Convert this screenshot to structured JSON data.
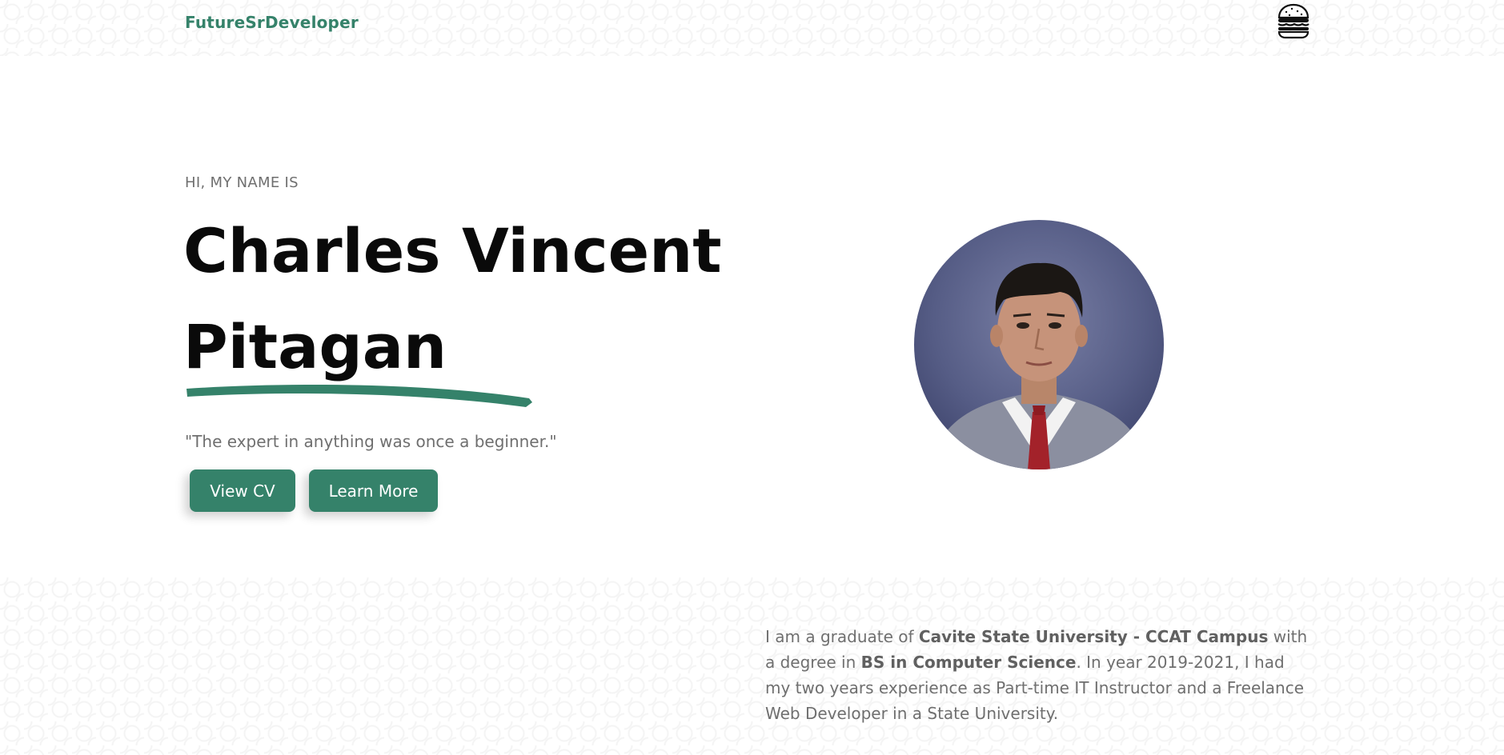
{
  "navbar": {
    "brand": "FutureSrDeveloper",
    "menu_icon": "hamburger-burger-icon"
  },
  "hero": {
    "greeting": "HI, MY NAME IS",
    "name_line1": "Charles Vincent",
    "name_line2": "Pitagan",
    "quote": "\"The expert in anything was once a beginner.\"",
    "buttons": {
      "view_cv": "View CV",
      "learn_more": "Learn More"
    },
    "photo": "profile-photo"
  },
  "about": {
    "p1": "I am a graduate of ",
    "school": "Cavite State University - CCAT Campus",
    "p2": " with a degree in ",
    "degree": "BS in Computer Science",
    "p3": ". In year 2019-2021, I had my two years experience as Part-time IT Instructor and a Freelance Web Developer in a State University."
  },
  "colors": {
    "accent": "#35826a",
    "heading": "#0a0a0a",
    "muted_text": "#6f6f6f",
    "background": "#ffffff"
  }
}
